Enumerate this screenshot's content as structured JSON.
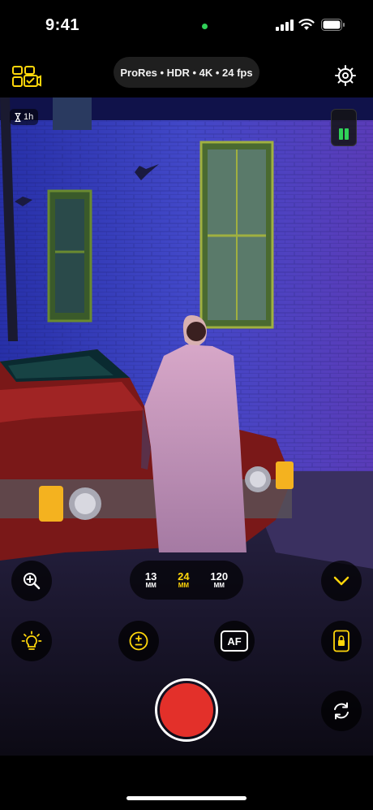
{
  "status": {
    "time": "9:41"
  },
  "format": {
    "label": "ProRes • HDR • 4K • 24 fps"
  },
  "viewfinder": {
    "timer_label": "1h"
  },
  "lenses": [
    {
      "num": "13",
      "unit": "MM"
    },
    {
      "num": "24",
      "unit": "MM"
    },
    {
      "num": "120",
      "unit": "MM"
    }
  ],
  "tools": {
    "af_label": "AF"
  },
  "colors": {
    "accent": "#ffd60a",
    "record": "#e3302a",
    "audio": "#30d158"
  },
  "icons": [
    "format-selector-icon",
    "settings-icon",
    "zoom-icon",
    "chevron-down-icon",
    "exposure-bulb-icon",
    "exposure-compensation-icon",
    "autofocus-icon",
    "orientation-lock-icon",
    "flip-camera-icon"
  ]
}
